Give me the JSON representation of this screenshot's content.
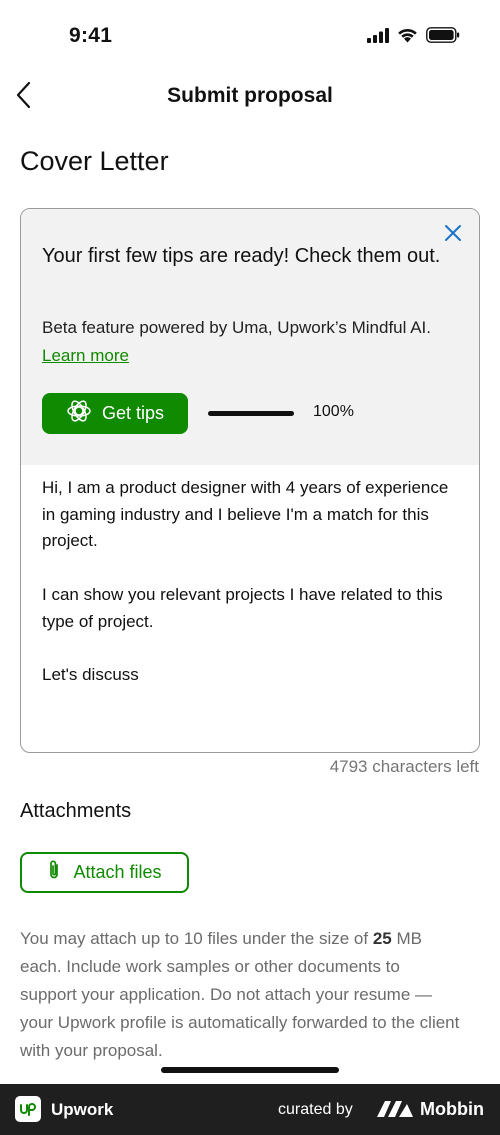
{
  "status_bar": {
    "time": "9:41"
  },
  "nav": {
    "title": "Submit proposal"
  },
  "cover_letter": {
    "title": "Cover Letter",
    "tips": {
      "heading": "Your first few tips are ready! Check them out.",
      "description": "Beta feature powered by Uma, Upwork’s Mindful AI.",
      "learn_more": "Learn more",
      "get_tips_label": "Get tips",
      "progress_percent": 100,
      "progress_label": "100%"
    },
    "text": "Hi, I am a product designer with 4 years of experience in gaming industry and I believe I'm a match for this project.\n\nI can show you relevant projects I have related to this type of project.\n\nLet's discuss",
    "chars_left": "4793 characters left"
  },
  "attachments": {
    "title": "Attachments",
    "button_label": "Attach files",
    "info_before": "You may attach up to 10 files under the size of ",
    "info_size": "25",
    "info_after": " MB each. Include work samples or other documents to support your application. Do not attach your resume — your Upwork profile is automatically forwarded to the client with your proposal."
  },
  "footer": {
    "brand": "Upwork",
    "curated_by": "curated by",
    "mobbin": "Mobbin"
  },
  "colors": {
    "accent_green": "#108a00",
    "link_blue": "#1a73c8",
    "footer_bg": "#1f1f1f"
  }
}
